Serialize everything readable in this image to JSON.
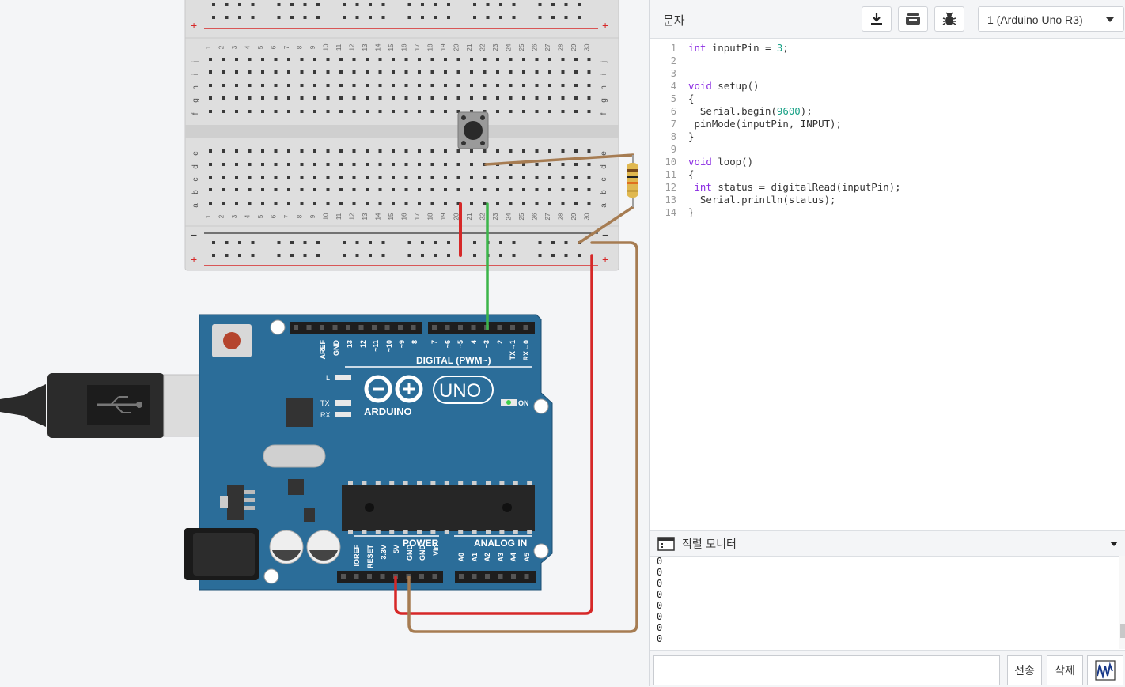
{
  "code_panel": {
    "mode_label": "문자",
    "toolbar": {
      "download_icon": "download-icon",
      "library_icon": "library-icon",
      "debug_icon": "bug-icon"
    },
    "board_select": {
      "value": "1 (Arduino Uno R3)"
    },
    "line_numbers": [
      "1",
      "2",
      "3",
      "4",
      "5",
      "6",
      "7",
      "8",
      "9",
      "10",
      "11",
      "12",
      "13",
      "14"
    ],
    "code": {
      "l1_kw": "int",
      "l1_rest": " inputPin = ",
      "l1_num": "3",
      "l1_end": ";",
      "l4_kw": "void",
      "l4_rest": " setup()",
      "l5": "{",
      "l6_a": "  Serial.begin(",
      "l6_num": "9600",
      "l6_b": ");",
      "l7": " pinMode(inputPin, INPUT);",
      "l8": "}",
      "l10_kw": "void",
      "l10_rest": " loop()",
      "l11": "{",
      "l12_kw": "int",
      "l12_rest": " status = digitalRead(inputPin);",
      "l13": "  Serial.println(status);",
      "l14": "}"
    }
  },
  "serial_monitor": {
    "title": "직렬 모니터",
    "lines": [
      "0",
      "0",
      "0",
      "0",
      "0",
      "0",
      "0",
      "0"
    ],
    "send_label": "전송",
    "clear_label": "삭제",
    "graph_icon": "graph-icon"
  },
  "arduino": {
    "brand": "ARDUINO",
    "model": "UNO",
    "on_label": "ON",
    "digital_label": "DIGITAL (PWM~)",
    "power_label": "POWER",
    "analog_label": "ANALOG IN",
    "led_l": "L",
    "led_tx": "TX",
    "led_rx": "RX",
    "top_pins": [
      "AREF",
      "GND",
      "13",
      "12",
      "~11",
      "~10",
      "~9",
      "8",
      "7",
      "~6",
      "~5",
      "4",
      "~3",
      "2",
      "TX→1",
      "RX←0"
    ],
    "power_pins": [
      "IOREF",
      "RESET",
      "3.3V",
      "5V",
      "GND",
      "GND",
      "Vin"
    ],
    "analog_pins": [
      "A0",
      "A1",
      "A2",
      "A3",
      "A4",
      "A5"
    ]
  },
  "breadboard": {
    "row_letters_top": [
      "j",
      "i",
      "h",
      "g",
      "f"
    ],
    "row_letters_bottom": [
      "e",
      "d",
      "c",
      "b",
      "a"
    ],
    "columns": 30,
    "plus": "+",
    "minus": "−"
  },
  "colors": {
    "arduino_blue": "#2b6d99",
    "wire_red": "#d62828",
    "wire_green": "#3cb54a",
    "wire_brown": "#a67c52",
    "keyword": "#8a2be2",
    "number": "#16a085"
  }
}
